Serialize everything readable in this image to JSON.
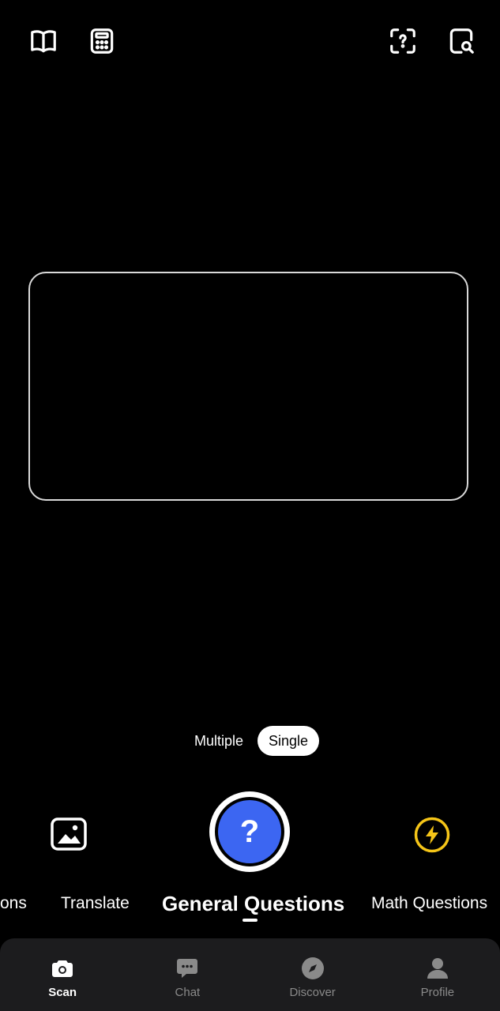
{
  "top_bar": {
    "left_icons": [
      "book-icon",
      "calculator-icon"
    ],
    "right_icons": [
      "scan-question-icon",
      "scan-search-icon"
    ]
  },
  "capture_mode": {
    "options": [
      "Multiple",
      "Single"
    ],
    "selected": "Single"
  },
  "controls": {
    "gallery_icon": "image-icon",
    "shutter_icon": "?",
    "flash_icon": "flash-icon",
    "shutter_color": "#3c66f2",
    "flash_color": "#f5c518"
  },
  "mode_tabs": {
    "items": [
      "ons",
      "Translate",
      "General Questions",
      "Math Questions"
    ],
    "active": "General Questions"
  },
  "bottom_nav": {
    "items": [
      {
        "label": "Scan",
        "icon": "camera-icon",
        "active": true
      },
      {
        "label": "Chat",
        "icon": "chat-icon",
        "active": false
      },
      {
        "label": "Discover",
        "icon": "compass-icon",
        "active": false
      },
      {
        "label": "Profile",
        "icon": "person-icon",
        "active": false
      }
    ]
  }
}
